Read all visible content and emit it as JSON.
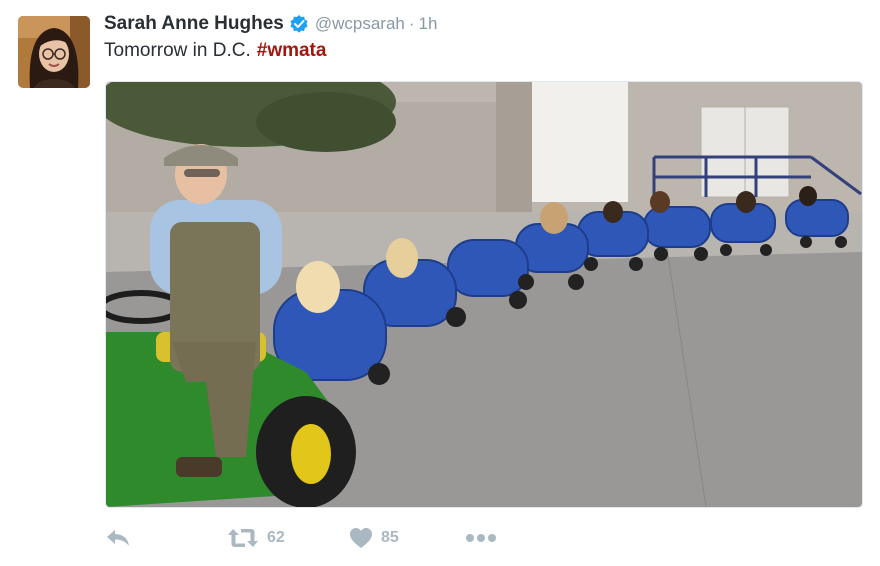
{
  "tweet": {
    "author_name": "Sarah Anne Hughes",
    "handle": "@wcpsarah",
    "separator": "·",
    "timestamp": "1h",
    "text": "Tomorrow in D.C.",
    "hashtag": "#wmata"
  },
  "actions": {
    "retweets": "62",
    "likes": "85"
  },
  "icons": {
    "verified": "verified-badge-icon",
    "reply": "reply-icon",
    "retweet": "retweet-icon",
    "like": "heart-icon",
    "more": "more-dots-icon"
  },
  "colors": {
    "hashtag": "#a0170f",
    "verified": "#1da1f2",
    "muted": "#8899a6",
    "action_icons": "#aab8c2"
  }
}
